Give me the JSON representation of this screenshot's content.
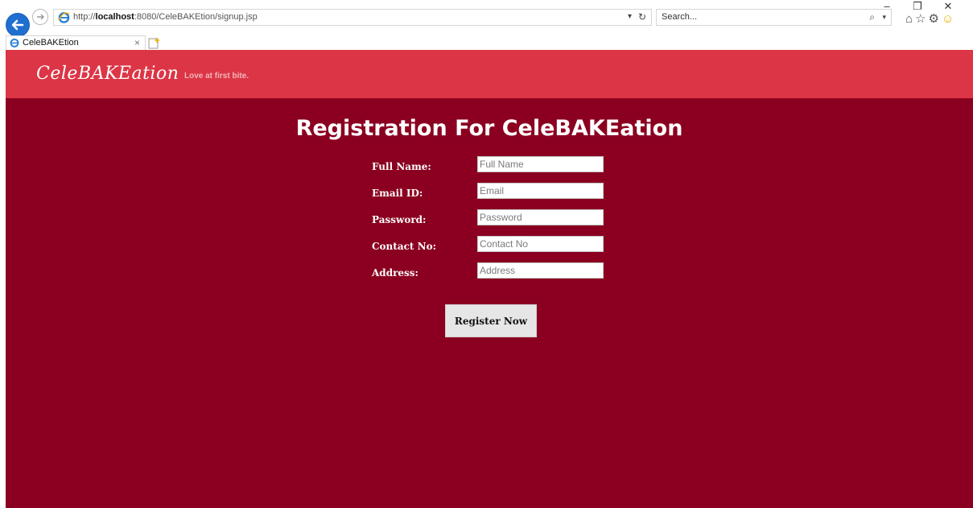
{
  "browser": {
    "url_prefix": "http://",
    "url_host": "localhost",
    "url_rest": ":8080/CeleBAKEtion/signup.jsp",
    "search_placeholder": "Search...",
    "tab_title": "CeleBAKEtion",
    "window_controls": {
      "minimize": "–",
      "restore": "❐",
      "close": "✕"
    }
  },
  "site": {
    "brand": "CeleBAKEation",
    "tagline": "Love at first bite."
  },
  "form": {
    "title": "Registration For CeleBAKEation",
    "fields": [
      {
        "label": "Full Name:",
        "placeholder": "Full Name",
        "value": ""
      },
      {
        "label": "Email ID:",
        "placeholder": "Email",
        "value": ""
      },
      {
        "label": "Password:",
        "placeholder": "Password",
        "value": ""
      },
      {
        "label": "Contact No:",
        "placeholder": "Contact No",
        "value": ""
      },
      {
        "label": "Address:",
        "placeholder": "Address",
        "value": ""
      }
    ],
    "submit_label": "Register Now"
  },
  "colors": {
    "header_bg": "#dc3545",
    "main_bg": "#8b0020",
    "tagline": "#f2b6bc"
  }
}
